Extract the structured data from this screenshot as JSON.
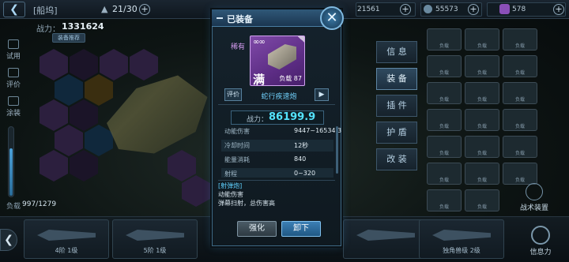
{
  "header": {
    "ship_name": "[船坞]",
    "ship_count": "21/30",
    "res1": "21561",
    "res2": "55573",
    "res3": "578"
  },
  "left": {
    "power_label": "战力：",
    "power_value": "1331624",
    "recommend_label": "装备推荐",
    "tool_trial": "试用",
    "tool_review": "评价",
    "tool_paint": "涂装",
    "load_label": "负载",
    "load_value": "997/1279"
  },
  "side_tabs": [
    "信 息",
    "装 备",
    "插 件",
    "护 盾",
    "改 装"
  ],
  "right": {
    "tactic_label": "战术装置",
    "info_power_label": "信息力"
  },
  "dock": {
    "card1_label": "4阶 1级",
    "card2_label": "5阶 1级",
    "card3_label": "",
    "card4_label": "独角兽级 2级"
  },
  "modal": {
    "title": "已装备",
    "close_icon": "close-icon",
    "rarity": "稀有",
    "card_level_mark": "∞∞",
    "card_full": "满",
    "card_load": "负载 87",
    "review_label": "评价",
    "item_name": "蛇行疾速炮",
    "play_icon": "▶",
    "power_label": "战力：",
    "power_value": "86199.9",
    "stats": [
      {
        "key": "动能伤害",
        "value": "9447~16534.3"
      },
      {
        "key": "冷却时间",
        "value": "12秒"
      },
      {
        "key": "能量消耗",
        "value": "840"
      },
      {
        "key": "射程",
        "value": "0~320"
      }
    ],
    "desc_title": "[射弹炮]",
    "desc_line1": "动能伤害",
    "desc_line2": "弹幕扫射，总伤害高",
    "strengthen_label": "强化",
    "unload_label": "卸下"
  },
  "colors": {
    "accent": "#54e3ff",
    "rarity_purple": "#7f4aa8",
    "primary_button": "#2a6a99"
  }
}
